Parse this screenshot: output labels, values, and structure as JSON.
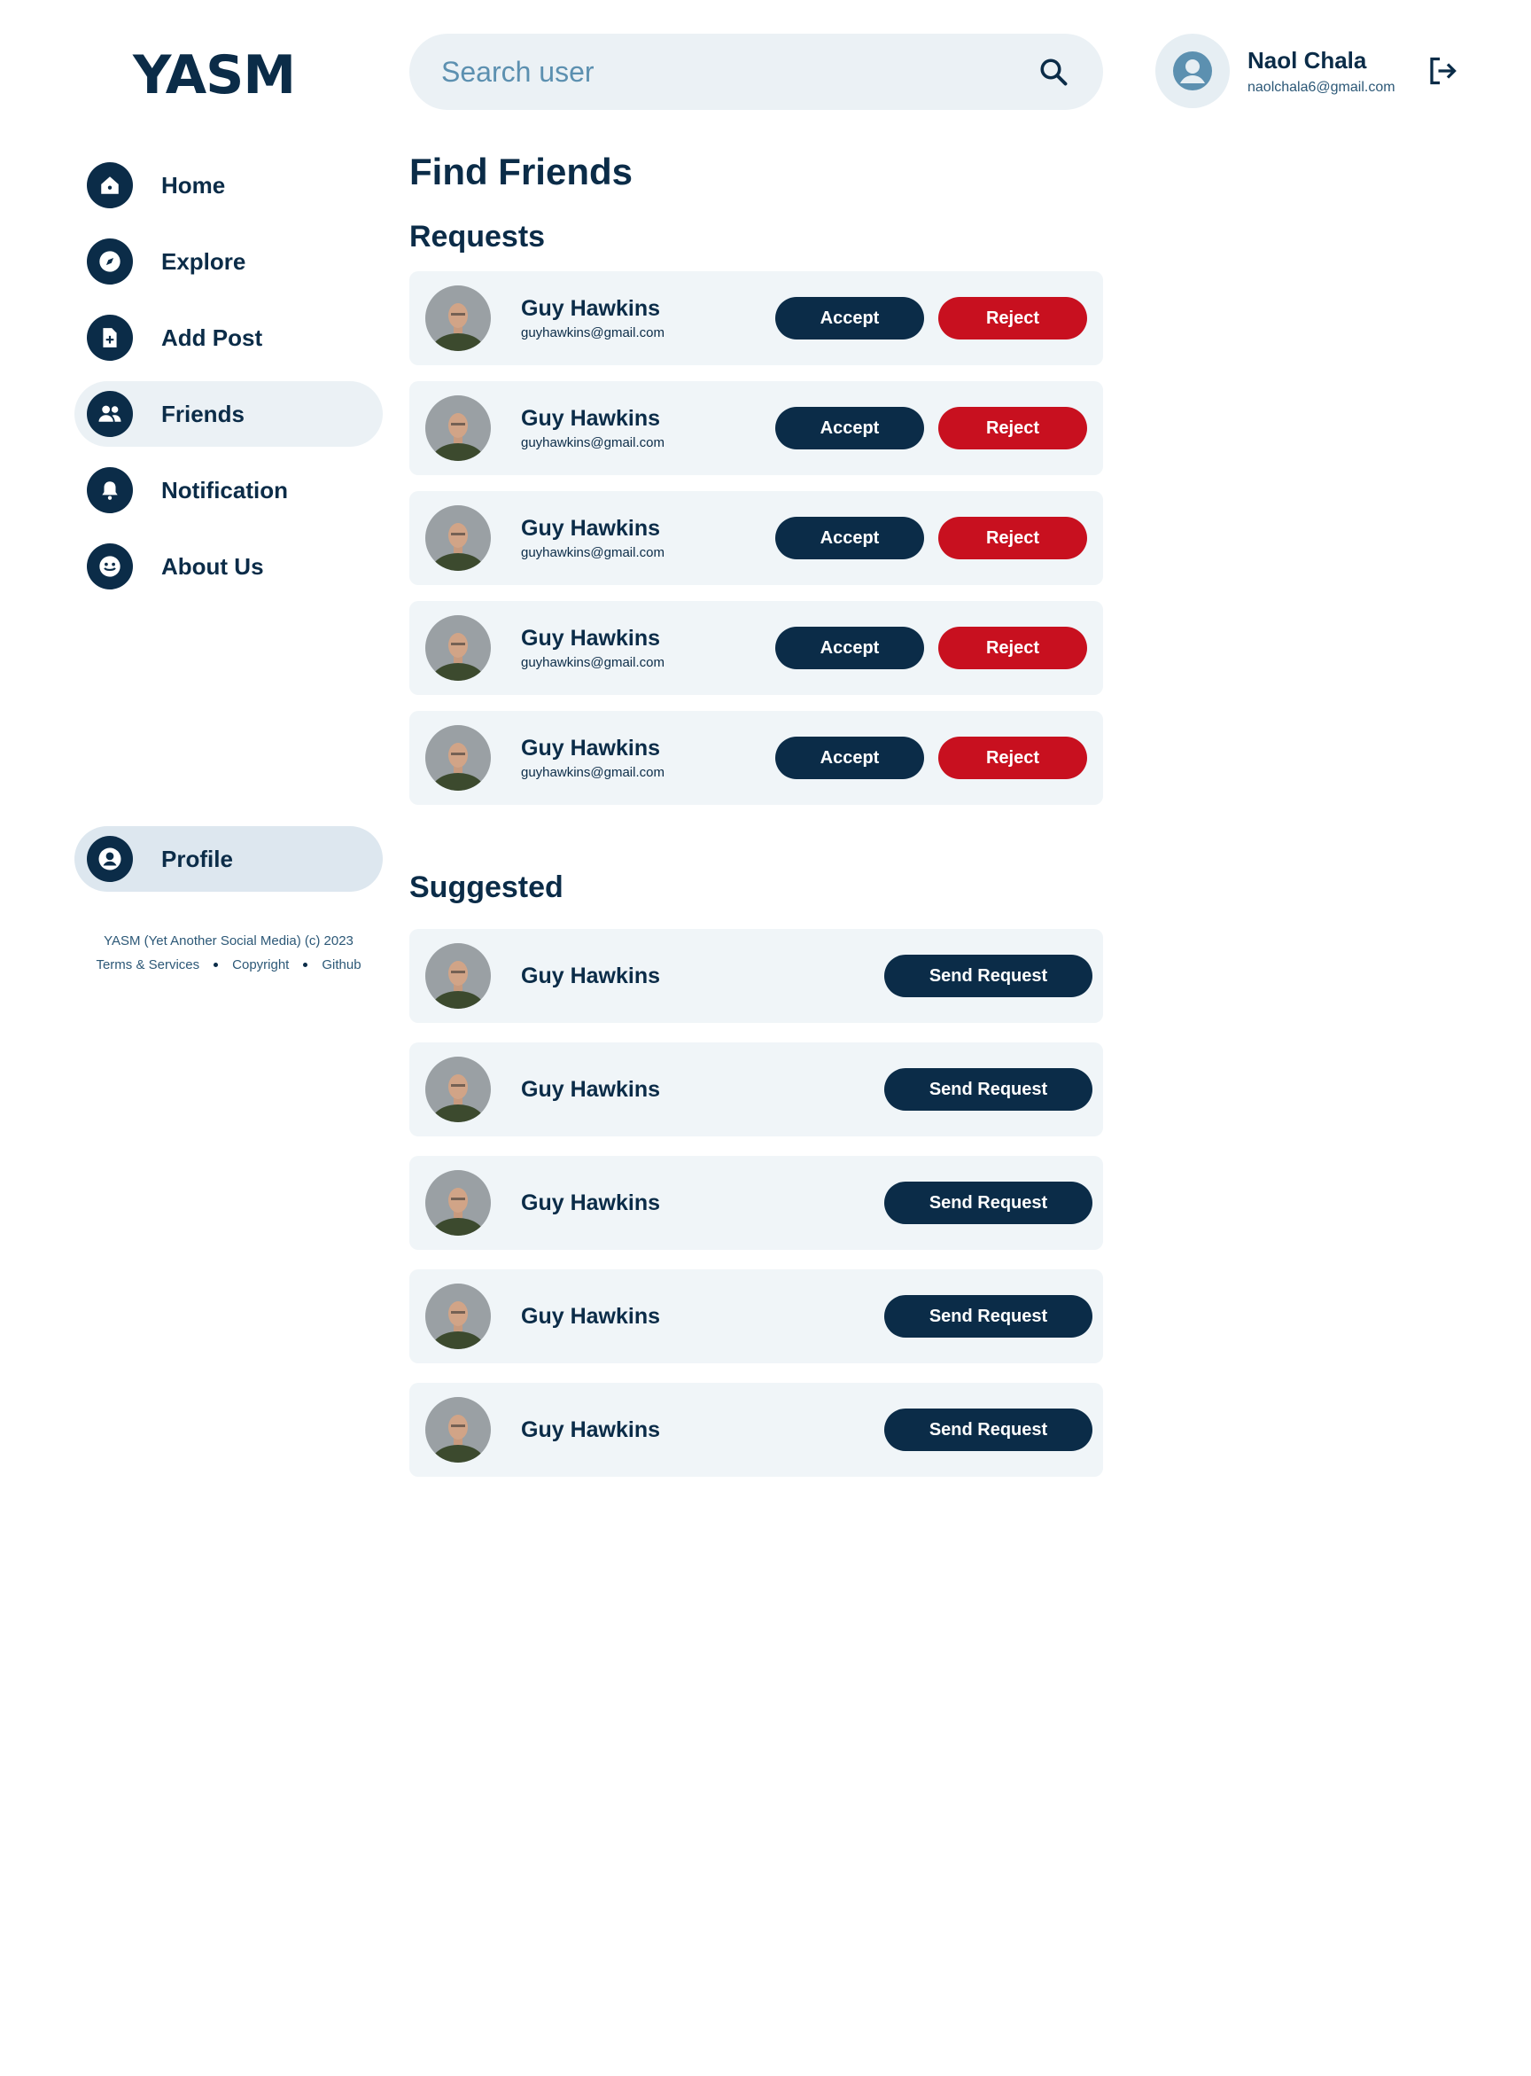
{
  "app": {
    "logo": "YASM"
  },
  "search": {
    "placeholder": "Search user"
  },
  "user": {
    "name": "Naol Chala",
    "email": "naolchala6@gmail.com"
  },
  "sidebar": {
    "items": [
      {
        "label": "Home",
        "icon": "home-icon"
      },
      {
        "label": "Explore",
        "icon": "compass-icon"
      },
      {
        "label": "Add Post",
        "icon": "add-file-icon"
      },
      {
        "label": "Friends",
        "icon": "friends-icon",
        "active": true
      },
      {
        "label": "Notification",
        "icon": "bell-icon"
      },
      {
        "label": "About Us",
        "icon": "smiley-icon"
      }
    ],
    "profile_label": "Profile"
  },
  "footer": {
    "copyright": "YASM (Yet Another Social Media) (c) 2023",
    "links": [
      "Terms & Services",
      "Copyright",
      "Github"
    ]
  },
  "main": {
    "title": "Find Friends",
    "requests_title": "Requests",
    "suggested_title": "Suggested",
    "accept_label": "Accept",
    "reject_label": "Reject",
    "send_label": "Send Request",
    "requests": [
      {
        "name": "Guy Hawkins",
        "email": "guyhawkins@gmail.com"
      },
      {
        "name": "Guy Hawkins",
        "email": "guyhawkins@gmail.com"
      },
      {
        "name": "Guy Hawkins",
        "email": "guyhawkins@gmail.com"
      },
      {
        "name": "Guy Hawkins",
        "email": "guyhawkins@gmail.com"
      },
      {
        "name": "Guy Hawkins",
        "email": "guyhawkins@gmail.com"
      }
    ],
    "suggested": [
      {
        "name": "Guy Hawkins"
      },
      {
        "name": "Guy Hawkins"
      },
      {
        "name": "Guy Hawkins"
      },
      {
        "name": "Guy Hawkins"
      },
      {
        "name": "Guy Hawkins"
      }
    ]
  },
  "colors": {
    "primary": "#0b2c48",
    "danger": "#c8101f",
    "card": "#f0f5f8",
    "accent_light": "#ebf1f5"
  }
}
